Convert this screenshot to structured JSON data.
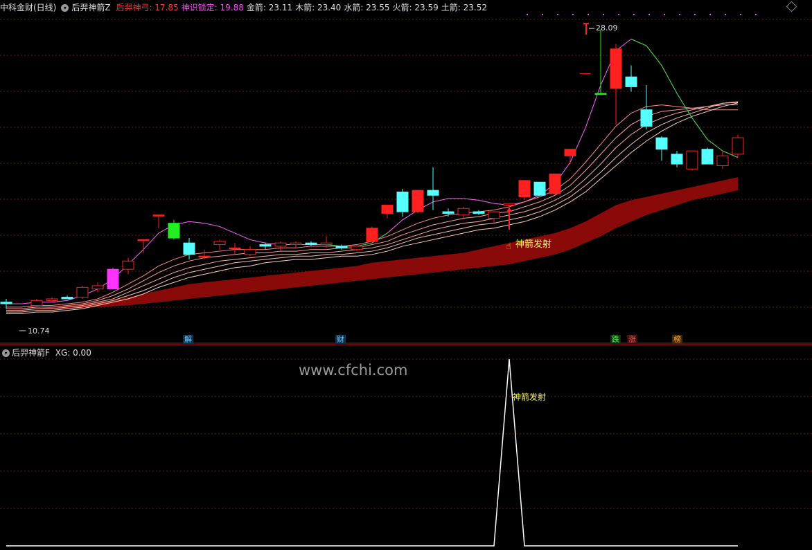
{
  "header": {
    "app": "中科金财(日线)",
    "indicator": "后羿神箭Z",
    "values": [
      {
        "label": "后羿神弓: 17.85",
        "color": "#ff3333"
      },
      {
        "label": "神识锁定: 19.88",
        "color": "#ff44ff"
      },
      {
        "label": "金箭: 23.11",
        "color": "#dddddd"
      },
      {
        "label": "木箭: 23.40",
        "color": "#dddddd"
      },
      {
        "label": "水箭: 23.55",
        "color": "#dddddd"
      },
      {
        "label": "火箭: 23.59",
        "color": "#dddddd"
      },
      {
        "label": "土箭: 23.52",
        "color": "#dddddd"
      }
    ]
  },
  "sub_header": {
    "indicator": "后羿神箭F",
    "xg": "XG: 0.00"
  },
  "watermark": "www.cfchi.com",
  "annotations": {
    "high_label": "28.09",
    "low_label": "10.74",
    "signal_main": "神箭发射",
    "signal_sub": "神箭发射"
  },
  "bottom_tags": [
    {
      "text": "解",
      "color": "#6ec8ff",
      "bg": "#103048"
    },
    {
      "text": "财",
      "color": "#6ec8ff",
      "bg": "#103048"
    },
    {
      "text": "跌",
      "color": "#55ff55",
      "bg": "#103010"
    },
    {
      "text": "涨",
      "color": "#ff5555",
      "bg": "#401010"
    },
    {
      "text": "榜",
      "color": "#ffaa33",
      "bg": "#3a2a10"
    }
  ],
  "chart_data": {
    "type": "candlestick",
    "ylim": [
      10.0,
      28.6
    ],
    "n": 49,
    "candles": [
      {
        "i": 0,
        "o": 11.3,
        "h": 11.6,
        "l": 11.0,
        "c": 11.4,
        "col": "cyan"
      },
      {
        "i": 2,
        "o": 11.2,
        "h": 11.6,
        "l": 11.1,
        "c": 11.5,
        "col": "red"
      },
      {
        "i": 3,
        "o": 11.5,
        "h": 11.7,
        "l": 11.4,
        "c": 11.6,
        "col": "red"
      },
      {
        "i": 4,
        "o": 11.7,
        "h": 11.8,
        "l": 11.6,
        "c": 11.6,
        "col": "cyan"
      },
      {
        "i": 5,
        "o": 11.7,
        "h": 12.4,
        "l": 11.6,
        "c": 12.3,
        "col": "red"
      },
      {
        "i": 6,
        "o": 12.2,
        "h": 12.6,
        "l": 12.0,
        "c": 12.4,
        "col": "red"
      },
      {
        "i": 7,
        "o": 12.2,
        "h": 13.5,
        "l": 12.2,
        "c": 13.4,
        "col": "magenta"
      },
      {
        "i": 8,
        "o": 13.4,
        "h": 14.1,
        "l": 13.1,
        "c": 13.9,
        "col": "red"
      },
      {
        "i": 9,
        "o": 15.2,
        "h": 15.2,
        "l": 14.4,
        "c": 15.2,
        "col": "red"
      },
      {
        "i": 10,
        "o": 16.7,
        "h": 16.7,
        "l": 15.9,
        "c": 16.7,
        "col": "red"
      },
      {
        "i": 11,
        "o": 16.2,
        "h": 16.4,
        "l": 15.2,
        "c": 15.3,
        "col": "green"
      },
      {
        "i": 12,
        "o": 15.0,
        "h": 15.3,
        "l": 14.0,
        "c": 14.3,
        "col": "cyan"
      },
      {
        "i": 13,
        "o": 14.2,
        "h": 14.6,
        "l": 14.0,
        "c": 14.2,
        "col": "red"
      },
      {
        "i": 14,
        "o": 14.9,
        "h": 15.2,
        "l": 14.6,
        "c": 15.1,
        "col": "red"
      },
      {
        "i": 15,
        "o": 14.7,
        "h": 15.0,
        "l": 14.3,
        "c": 14.7,
        "col": "red"
      },
      {
        "i": 16,
        "o": 14.3,
        "h": 14.8,
        "l": 14.2,
        "c": 14.6,
        "col": "red"
      },
      {
        "i": 17,
        "o": 14.9,
        "h": 15.0,
        "l": 14.6,
        "c": 14.8,
        "col": "cyan"
      },
      {
        "i": 18,
        "o": 14.8,
        "h": 15.1,
        "l": 14.5,
        "c": 15.0,
        "col": "red"
      },
      {
        "i": 19,
        "o": 14.9,
        "h": 15.1,
        "l": 14.7,
        "c": 15.0,
        "col": "red"
      },
      {
        "i": 20,
        "o": 15.0,
        "h": 15.1,
        "l": 14.8,
        "c": 14.9,
        "col": "cyan"
      },
      {
        "i": 21,
        "o": 14.9,
        "h": 15.4,
        "l": 14.7,
        "c": 15.0,
        "col": "red"
      },
      {
        "i": 22,
        "o": 14.8,
        "h": 14.9,
        "l": 14.6,
        "c": 14.7,
        "col": "cyan"
      },
      {
        "i": 23,
        "o": 14.6,
        "h": 14.9,
        "l": 14.5,
        "c": 14.8,
        "col": "red"
      },
      {
        "i": 24,
        "o": 15.1,
        "h": 16.0,
        "l": 15.0,
        "c": 15.9,
        "col": "red"
      },
      {
        "i": 25,
        "o": 16.8,
        "h": 17.3,
        "l": 16.5,
        "c": 17.3,
        "col": "red"
      },
      {
        "i": 26,
        "o": 18.1,
        "h": 18.3,
        "l": 16.6,
        "c": 16.9,
        "col": "cyan"
      },
      {
        "i": 27,
        "o": 16.9,
        "h": 18.2,
        "l": 16.8,
        "c": 18.2,
        "col": "red"
      },
      {
        "i": 28,
        "o": 17.9,
        "h": 19.6,
        "l": 17.0,
        "c": 18.2,
        "col": "cyan"
      },
      {
        "i": 29,
        "o": 16.9,
        "h": 17.1,
        "l": 16.6,
        "c": 16.8,
        "col": "cyan"
      },
      {
        "i": 30,
        "o": 16.7,
        "h": 17.2,
        "l": 16.5,
        "c": 17.1,
        "col": "red"
      },
      {
        "i": 31,
        "o": 16.9,
        "h": 17.0,
        "l": 16.7,
        "c": 16.8,
        "col": "cyan"
      },
      {
        "i": 32,
        "o": 16.5,
        "h": 16.9,
        "l": 16.2,
        "c": 16.9,
        "col": "red"
      },
      {
        "i": 33,
        "o": 17.3,
        "h": 17.4,
        "l": 15.8,
        "c": 17.4,
        "col": "red"
      },
      {
        "i": 34,
        "o": 17.8,
        "h": 18.8,
        "l": 17.6,
        "c": 18.8,
        "col": "red"
      },
      {
        "i": 35,
        "o": 18.7,
        "h": 18.7,
        "l": 17.9,
        "c": 17.9,
        "col": "cyan"
      },
      {
        "i": 36,
        "o": 18.0,
        "h": 19.2,
        "l": 17.9,
        "c": 19.2,
        "col": "red"
      },
      {
        "i": 37,
        "o": 20.7,
        "h": 20.7,
        "l": 19.8,
        "c": 20.3,
        "col": "red"
      },
      {
        "i": 39,
        "o": 24.1,
        "h": 28.0,
        "l": 24.1,
        "c": 24.1,
        "col": "green"
      },
      {
        "i": 40,
        "o": 24.4,
        "h": 27.1,
        "l": 22.2,
        "c": 26.8,
        "col": "red"
      },
      {
        "i": 41,
        "o": 24.5,
        "h": 25.8,
        "l": 24.2,
        "c": 25.1,
        "col": "cyan"
      },
      {
        "i": 42,
        "o": 23.1,
        "h": 24.6,
        "l": 21.9,
        "c": 22.1,
        "col": "cyan"
      },
      {
        "i": 43,
        "o": 21.4,
        "h": 21.5,
        "l": 20.0,
        "c": 20.7,
        "col": "cyan"
      },
      {
        "i": 44,
        "o": 20.4,
        "h": 20.6,
        "l": 19.6,
        "c": 19.8,
        "col": "cyan"
      },
      {
        "i": 45,
        "o": 19.5,
        "h": 20.6,
        "l": 19.4,
        "c": 20.6,
        "col": "red"
      },
      {
        "i": 46,
        "o": 20.7,
        "h": 20.8,
        "l": 19.8,
        "c": 19.8,
        "col": "cyan"
      },
      {
        "i": 47,
        "o": 19.7,
        "h": 20.6,
        "l": 19.5,
        "c": 20.3,
        "col": "red"
      },
      {
        "i": 48,
        "o": 20.4,
        "h": 21.6,
        "l": 20.2,
        "c": 21.4,
        "col": "red"
      }
    ],
    "signal_candle": {
      "i": 33,
      "arrow_low": 15.8,
      "arrow_high": 17.1
    },
    "ma_lines": [
      {
        "name": "后羿神弓",
        "color": "#ff66ff",
        "values": [
          11.3,
          11.3,
          11.4,
          11.4,
          11.5,
          11.8,
          12.2,
          12.8,
          13.7,
          14.6,
          15.6,
          16.1,
          16.3,
          16.2,
          16.0,
          15.6,
          15.2,
          15.0,
          14.9,
          14.9,
          14.9,
          14.9,
          14.8,
          14.8,
          15.0,
          15.6,
          16.4,
          17.0,
          17.5,
          17.7,
          17.7,
          17.6,
          17.4,
          17.3,
          17.5,
          17.9,
          18.6,
          19.9,
          22.0,
          24.6,
          26.7,
          27.4,
          27.0,
          25.8,
          24.1,
          22.6,
          21.3,
          20.6,
          20.2
        ]
      },
      {
        "name": "金箭",
        "color": "#ff8888",
        "values": [
          11.1,
          11.1,
          11.2,
          11.2,
          11.3,
          11.4,
          11.6,
          12.0,
          12.5,
          13.0,
          13.6,
          14.0,
          14.3,
          14.4,
          14.5,
          14.6,
          14.6,
          14.6,
          14.7,
          14.7,
          14.8,
          14.8,
          14.8,
          14.9,
          15.1,
          15.4,
          15.8,
          16.2,
          16.5,
          16.7,
          16.8,
          16.9,
          17.0,
          17.2,
          17.5,
          17.8,
          18.2,
          18.9,
          19.9,
          21.0,
          22.1,
          22.9,
          23.3,
          23.4,
          23.3,
          23.2,
          23.1,
          23.1,
          23.1
        ]
      },
      {
        "name": "木箭",
        "color": "#ff9f9f",
        "values": [
          11.0,
          11.0,
          11.1,
          11.1,
          11.2,
          11.3,
          11.5,
          11.8,
          12.2,
          12.7,
          13.2,
          13.6,
          13.9,
          14.1,
          14.2,
          14.3,
          14.4,
          14.4,
          14.5,
          14.5,
          14.6,
          14.6,
          14.7,
          14.7,
          14.9,
          15.1,
          15.5,
          15.8,
          16.1,
          16.3,
          16.5,
          16.6,
          16.8,
          16.9,
          17.2,
          17.5,
          17.9,
          18.5,
          19.4,
          20.4,
          21.4,
          22.2,
          22.7,
          23.0,
          23.1,
          23.2,
          23.3,
          23.4,
          23.4
        ]
      },
      {
        "name": "水箭",
        "color": "#ffb0a0",
        "values": [
          10.9,
          10.9,
          11.0,
          11.0,
          11.1,
          11.2,
          11.4,
          11.6,
          12.0,
          12.4,
          12.8,
          13.2,
          13.5,
          13.7,
          13.9,
          14.0,
          14.1,
          14.2,
          14.3,
          14.3,
          14.4,
          14.4,
          14.5,
          14.6,
          14.7,
          14.9,
          15.2,
          15.5,
          15.8,
          16.0,
          16.2,
          16.3,
          16.5,
          16.7,
          16.9,
          17.2,
          17.6,
          18.1,
          18.9,
          19.8,
          20.8,
          21.6,
          22.2,
          22.6,
          22.9,
          23.1,
          23.3,
          23.5,
          23.55
        ]
      },
      {
        "name": "火箭",
        "color": "#ffc0b0",
        "values": [
          10.8,
          10.8,
          10.9,
          10.9,
          11.0,
          11.1,
          11.3,
          11.5,
          11.8,
          12.1,
          12.5,
          12.9,
          13.2,
          13.4,
          13.6,
          13.8,
          13.9,
          14.0,
          14.1,
          14.2,
          14.2,
          14.3,
          14.3,
          14.4,
          14.5,
          14.7,
          15.0,
          15.3,
          15.5,
          15.7,
          15.9,
          16.1,
          16.2,
          16.4,
          16.6,
          16.9,
          17.3,
          17.8,
          18.5,
          19.3,
          20.2,
          21.0,
          21.7,
          22.2,
          22.6,
          22.9,
          23.2,
          23.5,
          23.59
        ]
      },
      {
        "name": "土箭",
        "color": "#ffd0c0",
        "values": [
          10.7,
          10.7,
          10.8,
          10.8,
          10.9,
          11.0,
          11.2,
          11.4,
          11.6,
          11.9,
          12.3,
          12.6,
          12.9,
          13.1,
          13.3,
          13.5,
          13.6,
          13.8,
          13.9,
          14.0,
          14.0,
          14.1,
          14.2,
          14.2,
          14.3,
          14.5,
          14.8,
          15.0,
          15.2,
          15.4,
          15.6,
          15.8,
          15.9,
          16.1,
          16.3,
          16.6,
          17.0,
          17.5,
          18.1,
          18.9,
          19.7,
          20.5,
          21.2,
          21.8,
          22.3,
          22.7,
          23.0,
          23.3,
          23.52
        ]
      }
    ],
    "band": {
      "color": "#8a0a0a",
      "upper": [
        10.9,
        10.95,
        11.0,
        11.1,
        11.2,
        11.3,
        11.4,
        11.5,
        11.7,
        11.9,
        12.1,
        12.3,
        12.5,
        12.6,
        12.7,
        12.8,
        12.9,
        13.0,
        13.1,
        13.2,
        13.3,
        13.4,
        13.5,
        13.6,
        13.8,
        13.9,
        14.0,
        14.1,
        14.2,
        14.3,
        14.4,
        14.6,
        14.8,
        15.0,
        15.2,
        15.4,
        15.6,
        15.9,
        16.3,
        16.8,
        17.3,
        17.6,
        17.8,
        18.0,
        18.2,
        18.4,
        18.6,
        18.8,
        19.0
      ],
      "lower": [
        10.85,
        10.9,
        10.95,
        11.0,
        11.0,
        11.05,
        11.1,
        11.15,
        11.2,
        11.3,
        11.4,
        11.5,
        11.6,
        11.7,
        11.8,
        11.9,
        12.0,
        12.1,
        12.2,
        12.3,
        12.4,
        12.5,
        12.6,
        12.7,
        12.8,
        12.9,
        13.0,
        13.1,
        13.2,
        13.3,
        13.4,
        13.5,
        13.6,
        13.7,
        13.9,
        14.1,
        14.3,
        14.6,
        15.0,
        15.4,
        15.9,
        16.3,
        16.7,
        17.0,
        17.3,
        17.6,
        17.8,
        18.0,
        18.2
      ]
    },
    "sub": {
      "type": "line",
      "ylim": [
        0,
        1
      ],
      "values": [
        0,
        0,
        0,
        0,
        0,
        0,
        0,
        0,
        0,
        0,
        0,
        0,
        0,
        0,
        0,
        0,
        0,
        0,
        0,
        0,
        0,
        0,
        0,
        0,
        0,
        0,
        0,
        0,
        0,
        0,
        0,
        0,
        0,
        1,
        0,
        0,
        0,
        0,
        0,
        0,
        0,
        0,
        0,
        0,
        0,
        0,
        0,
        0,
        0
      ]
    }
  }
}
